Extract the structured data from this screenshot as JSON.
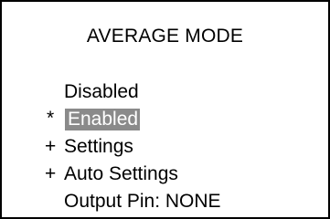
{
  "screen": {
    "title": "AVERAGE MODE",
    "selection_highlight_color": "#8a8a8a",
    "items": [
      {
        "marker": "",
        "label": "Disabled",
        "selected": false
      },
      {
        "marker": "*",
        "label": "Enabled",
        "selected": true
      },
      {
        "marker": "+",
        "label": "Settings",
        "selected": false
      },
      {
        "marker": "+",
        "label": "Auto Settings",
        "selected": false
      },
      {
        "marker": "",
        "label": "Output Pin: NONE",
        "selected": false
      }
    ]
  }
}
